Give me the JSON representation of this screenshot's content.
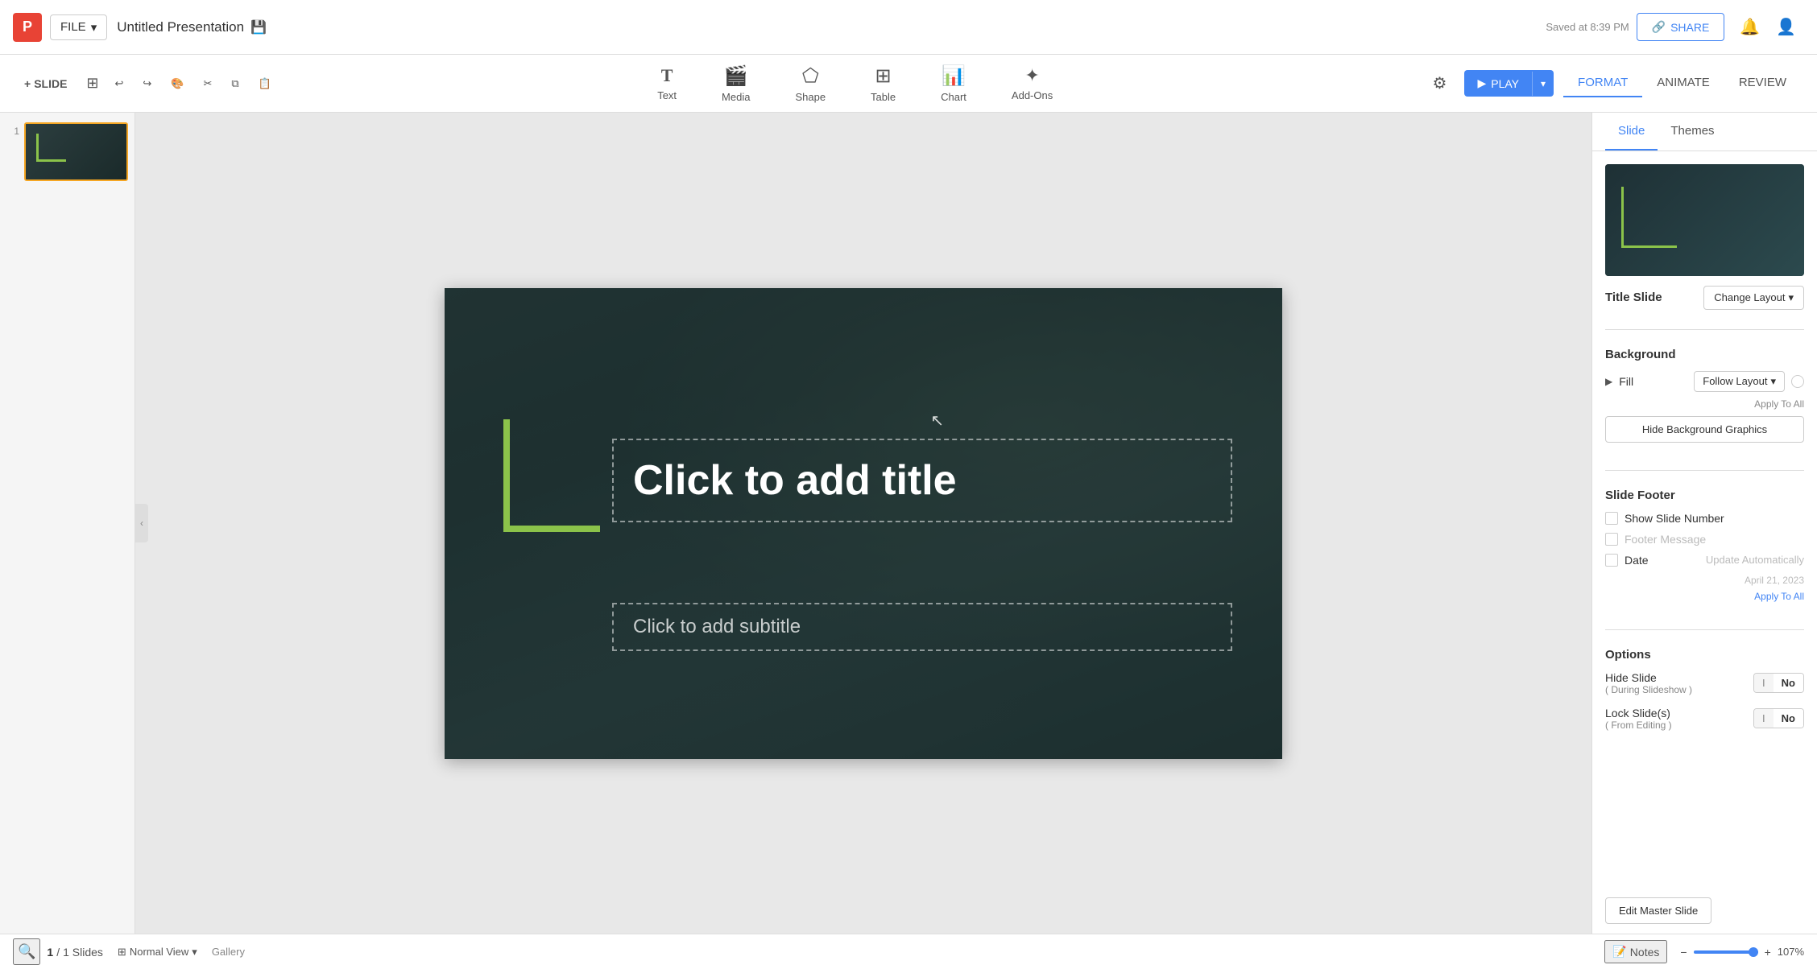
{
  "app": {
    "logo": "P",
    "file_menu": "FILE",
    "title": "Untitled Presentation",
    "save_icon": "💾",
    "saved_text": "Saved at 8:39 PM",
    "share_label": "SHARE"
  },
  "toolbar": {
    "undo_label": "↩",
    "redo_label": "↪",
    "format_label": "🎨",
    "cut_label": "✂",
    "copy_label": "⧉",
    "paste_label": "📋",
    "tools": [
      {
        "icon": "T",
        "label": "Text"
      },
      {
        "icon": "▶",
        "label": "Media"
      },
      {
        "icon": "⬟",
        "label": "Shape"
      },
      {
        "icon": "⊞",
        "label": "Table"
      },
      {
        "icon": "📊",
        "label": "Chart"
      },
      {
        "icon": "＋",
        "label": "Add-Ons"
      }
    ],
    "settings_icon": "⚙",
    "play_label": "PLAY",
    "format_tab": "FORMAT",
    "animate_tab": "ANIMATE",
    "review_tab": "REVIEW",
    "slide_label": "SLIDE",
    "add_slide_icon": "+"
  },
  "slide_panel": {
    "slide_number": "1"
  },
  "slide": {
    "title_placeholder": "Click to add title",
    "subtitle_placeholder": "Click to add subtitle"
  },
  "right_panel": {
    "tabs": [
      "Slide",
      "Themes"
    ],
    "active_tab": "Slide",
    "slide_label": "Title Slide",
    "change_layout_label": "Change Layout",
    "background_section": "Background",
    "fill_label": "Fill",
    "follow_layout_label": "Follow Layout",
    "apply_to_all_gray": "Apply To All",
    "hide_bg_btn": "Hide Background Graphics",
    "slide_footer_section": "Slide Footer",
    "show_slide_number_label": "Show Slide Number",
    "footer_message_label": "Footer Message",
    "date_label": "Date",
    "update_automatically_label": "Update Automatically",
    "date_value": "April 21, 2023",
    "apply_to_all_blue": "Apply To All",
    "options_section": "Options",
    "hide_slide_label": "Hide Slide",
    "hide_slide_sub": "( During Slideshow )",
    "hide_slide_no": "No",
    "hide_slide_toggle_off": "I",
    "lock_slide_label": "Lock Slide(s)",
    "lock_slide_sub": "( From Editing )",
    "lock_slide_no": "No",
    "lock_slide_toggle_off": "I",
    "edit_master_btn": "Edit Master Slide"
  },
  "bottom_bar": {
    "gallery_label": "Gallery",
    "page_current": "1",
    "page_total": "1 Slides",
    "view_mode": "Normal View",
    "notes_label": "Notes",
    "zoom_pct": "107%"
  }
}
